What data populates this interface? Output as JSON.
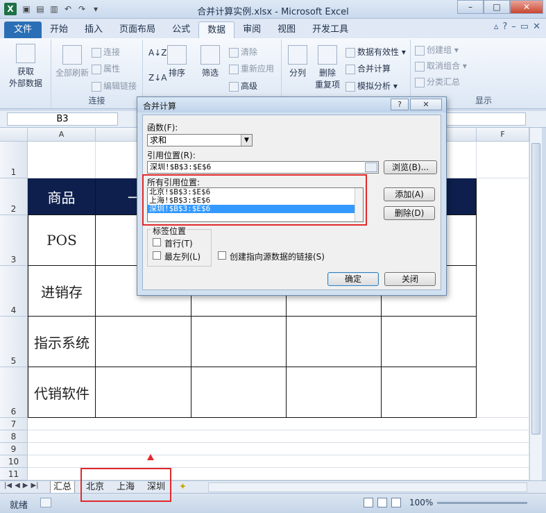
{
  "window": {
    "title": "合并计算实例.xlsx - Microsoft Excel",
    "app_icon": "X"
  },
  "tabs": {
    "file": "文件",
    "items": [
      "开始",
      "插入",
      "页面布局",
      "公式",
      "数据",
      "审阅",
      "视图",
      "开发工具"
    ],
    "active": "数据"
  },
  "ribbon": {
    "get_external": "获取\n外部数据",
    "get_external_l1": "获取",
    "get_external_l2": "外部数据",
    "refresh_all": "全部刷新",
    "connections": "连接",
    "properties": "属性",
    "edit_links": "编辑链接",
    "group_connections": "连接",
    "sort": "排序",
    "filter": "筛选",
    "clear": "清除",
    "reapply": "重新应用",
    "advanced": "高级",
    "split": "分列",
    "remove_dup_l1": "删除",
    "remove_dup_l2": "重复项",
    "data_validation": "数据有效性",
    "consolidate": "合并计算",
    "what_if": "模拟分析",
    "group": "创建组",
    "ungroup": "取消组合",
    "subtotal": "分类汇总",
    "group_outline": "显示"
  },
  "formula_bar": {
    "name_box": "B3"
  },
  "grid": {
    "columns": [
      "A",
      "F"
    ],
    "rows": [
      "1",
      "2",
      "3",
      "4",
      "5",
      "6",
      "7",
      "8",
      "9",
      "10",
      "11"
    ],
    "table_header": "商品",
    "table_header_b": "一",
    "items": [
      "POS",
      "进销存",
      "指示系统",
      "代销软件"
    ]
  },
  "dialog": {
    "title": "合并计算",
    "help": "?",
    "close": "✕",
    "function_label": "函数(F):",
    "function_value": "求和",
    "reference_label": "引用位置(R):",
    "reference_value": "深圳!$B$3:$E$6",
    "browse": "浏览(B)...",
    "all_refs_label": "所有引用位置:",
    "all_refs": [
      "北京!$B$3:$E$6",
      "上海!$B$3:$E$6",
      "深圳!$B$3:$E$6"
    ],
    "add": "添加(A)",
    "delete": "删除(D)",
    "use_labels": "标签位置",
    "top_row": "首行(T)",
    "left_column": "最左列(L)",
    "create_links": "创建指向源数据的链接(S)",
    "ok": "确定",
    "close_btn": "关闭"
  },
  "sheets": [
    "汇总",
    "北京",
    "上海",
    "深圳"
  ],
  "active_sheet": "汇总",
  "status": {
    "ready": "就绪",
    "zoom": "100%"
  },
  "colors": {
    "header_fill": "#0e1f4d",
    "highlight": "#e1292b",
    "selection": "#3399ff"
  }
}
